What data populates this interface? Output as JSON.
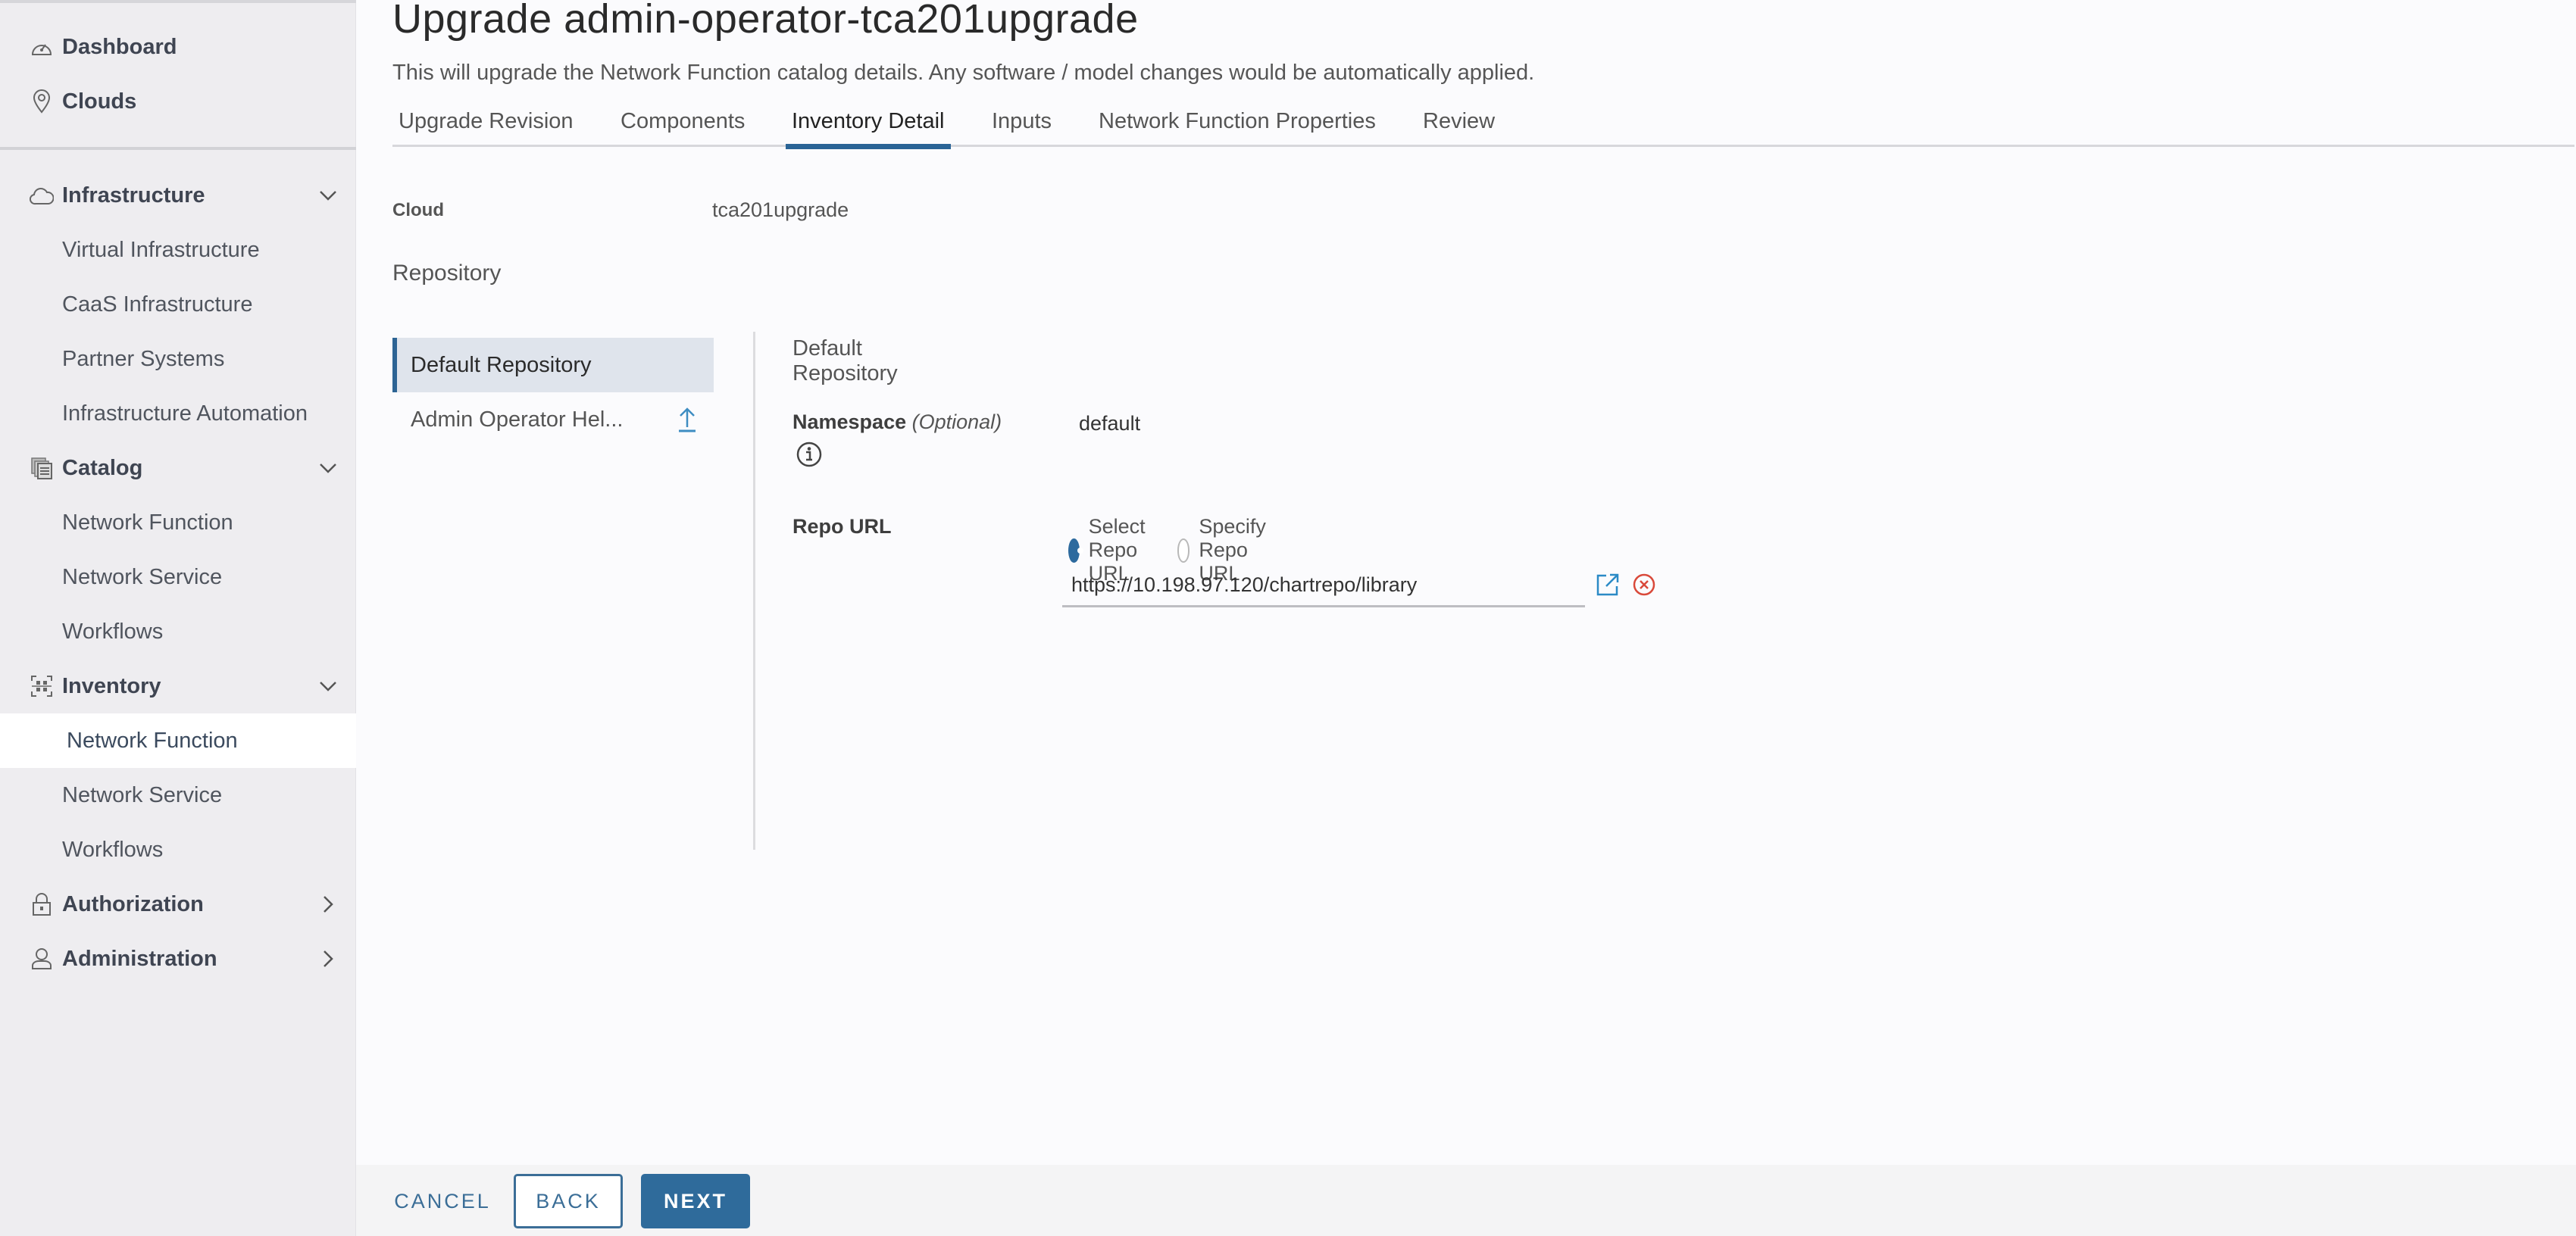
{
  "sidebar": {
    "items": [
      {
        "label": "Dashboard",
        "icon": "dashboard-icon",
        "type": "top"
      },
      {
        "label": "Clouds",
        "icon": "location-pin-icon",
        "type": "top"
      },
      {
        "label": "Infrastructure",
        "icon": "cloud-icon",
        "type": "group",
        "expanded": true
      },
      {
        "label": "Virtual Infrastructure",
        "type": "sub"
      },
      {
        "label": "CaaS Infrastructure",
        "type": "sub"
      },
      {
        "label": "Partner Systems",
        "type": "sub"
      },
      {
        "label": "Infrastructure Automation",
        "type": "sub"
      },
      {
        "label": "Catalog",
        "icon": "catalog-icon",
        "type": "group",
        "expanded": true
      },
      {
        "label": "Network Function",
        "type": "sub"
      },
      {
        "label": "Network Service",
        "type": "sub"
      },
      {
        "label": "Workflows",
        "type": "sub"
      },
      {
        "label": "Inventory",
        "icon": "inventory-icon",
        "type": "group",
        "expanded": true
      },
      {
        "label": "Network Function",
        "type": "sub",
        "active": true
      },
      {
        "label": "Network Service",
        "type": "sub"
      },
      {
        "label": "Workflows",
        "type": "sub"
      },
      {
        "label": "Authorization",
        "icon": "lock-icon",
        "type": "group",
        "expanded": false
      },
      {
        "label": "Administration",
        "icon": "user-icon",
        "type": "group",
        "expanded": false
      }
    ]
  },
  "header": {
    "title": "Upgrade admin-operator-tca201upgrade",
    "subtitle": "This will upgrade the Network Function catalog details. Any software / model changes would be automatically applied."
  },
  "tabs": [
    {
      "label": "Upgrade Revision"
    },
    {
      "label": "Components"
    },
    {
      "label": "Inventory Detail",
      "active": true
    },
    {
      "label": "Inputs"
    },
    {
      "label": "Network Function Properties"
    },
    {
      "label": "Review"
    }
  ],
  "inventory": {
    "cloud_label": "Cloud",
    "cloud_value": "tca201upgrade",
    "repository_title": "Repository",
    "repo_list": [
      {
        "label": "Default Repository",
        "active": true
      },
      {
        "label": "Admin Operator Hel...",
        "icon": "upload-icon"
      }
    ],
    "detail": {
      "title": "Default Repository",
      "namespace_label": "Namespace",
      "namespace_optional": "(Optional)",
      "namespace_value": "default",
      "repo_url_label": "Repo URL",
      "radio_options": [
        {
          "label": "Select Repo URL",
          "checked": true
        },
        {
          "label": "Specify Repo URL",
          "checked": false
        }
      ],
      "repo_url_value": "https://10.198.97.120/chartrepo/library"
    }
  },
  "footer": {
    "cancel_label": "CANCEL",
    "back_label": "BACK",
    "next_label": "NEXT"
  },
  "colors": {
    "accent": "#2f6b9b",
    "error": "#d9493a",
    "link": "#2b8ac6"
  }
}
